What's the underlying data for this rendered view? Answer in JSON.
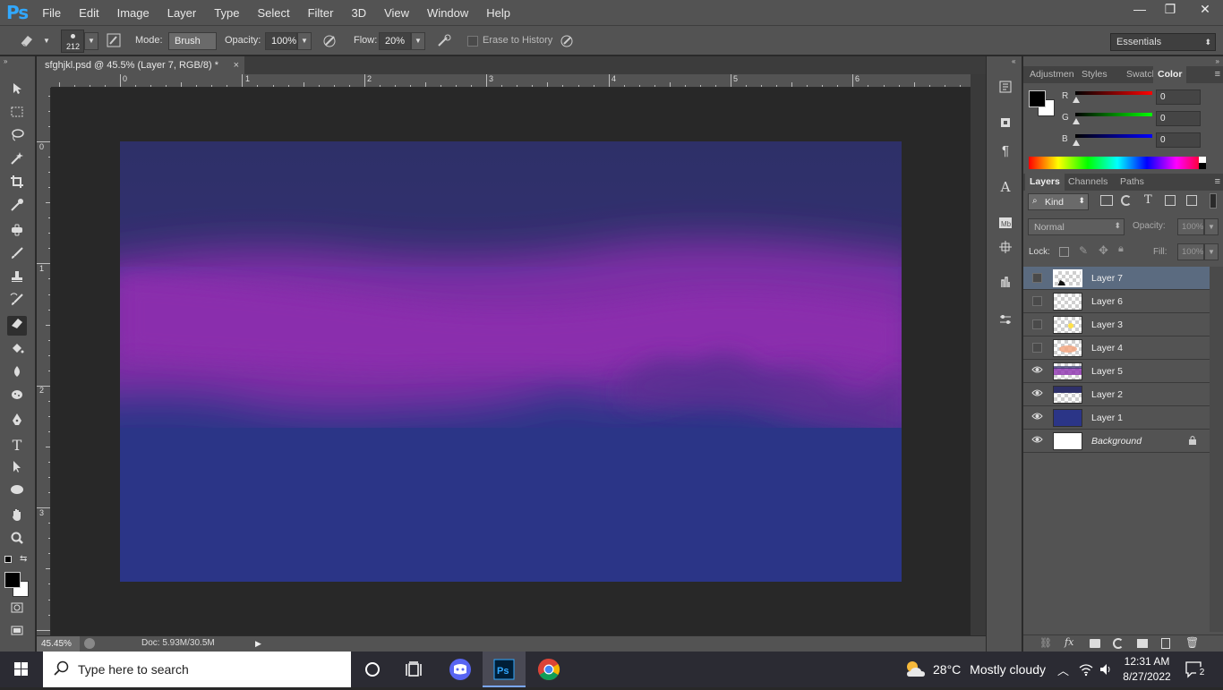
{
  "app": {
    "logo": "Ps",
    "menu": [
      "File",
      "Edit",
      "Image",
      "Layer",
      "Type",
      "Select",
      "Filter",
      "3D",
      "View",
      "Window",
      "Help"
    ],
    "window_controls": {
      "minimize": "—",
      "restore": "❐",
      "close": "✕"
    }
  },
  "options": {
    "brush_size": "212",
    "mode_label": "Mode:",
    "mode_value": "Brush",
    "opacity_label": "Opacity:",
    "opacity_value": "100%",
    "flow_label": "Flow:",
    "flow_value": "20%",
    "erase_history_label": "Erase to History",
    "workspace": "Essentials"
  },
  "document": {
    "tab_title": "sfghjkl.psd @ 45.5% (Layer 7, RGB/8) *",
    "close": "×",
    "ruler_top_labels": [
      "0",
      "1",
      "2",
      "3",
      "4",
      "5",
      "6"
    ],
    "ruler_left_labels": [
      "0",
      "1",
      "2",
      "3"
    ],
    "zoom": "45.45%",
    "doc_size": "Doc: 5.93M/30.5M"
  },
  "panels": {
    "top_tabs": [
      "Adjustmen",
      "Styles",
      "Swatches",
      "Color"
    ],
    "color": {
      "r_label": "R",
      "r_value": "0",
      "g_label": "G",
      "g_value": "0",
      "b_label": "B",
      "b_value": "0"
    },
    "layer_tabs": [
      "Layers",
      "Channels",
      "Paths"
    ],
    "kind_label": "Kind",
    "blend_mode": "Normal",
    "opacity_label": "Opacity:",
    "opacity_value": "100%",
    "lock_label": "Lock:",
    "fill_label": "Fill:",
    "fill_value": "100%",
    "layers": [
      {
        "name": "Layer 7",
        "visible": false,
        "selected": true
      },
      {
        "name": "Layer 6",
        "visible": false,
        "selected": false
      },
      {
        "name": "Layer 3",
        "visible": false,
        "selected": false
      },
      {
        "name": "Layer 4",
        "visible": false,
        "selected": false
      },
      {
        "name": "Layer 5",
        "visible": true,
        "selected": false
      },
      {
        "name": "Layer 2",
        "visible": true,
        "selected": false
      },
      {
        "name": "Layer 1",
        "visible": true,
        "selected": false
      },
      {
        "name": "Background",
        "visible": true,
        "selected": false,
        "locked": true
      }
    ]
  },
  "taskbar": {
    "search_placeholder": "Type here to search",
    "weather_temp": "28°C",
    "weather_text": "Mostly cloudy",
    "time": "12:31 AM",
    "date": "8/27/2022",
    "notification_count": "2"
  },
  "colors": {
    "ps_blue": "#31a8ff",
    "canvas_navy": "#2a3585",
    "canvas_purple": "#8a2ea8"
  }
}
